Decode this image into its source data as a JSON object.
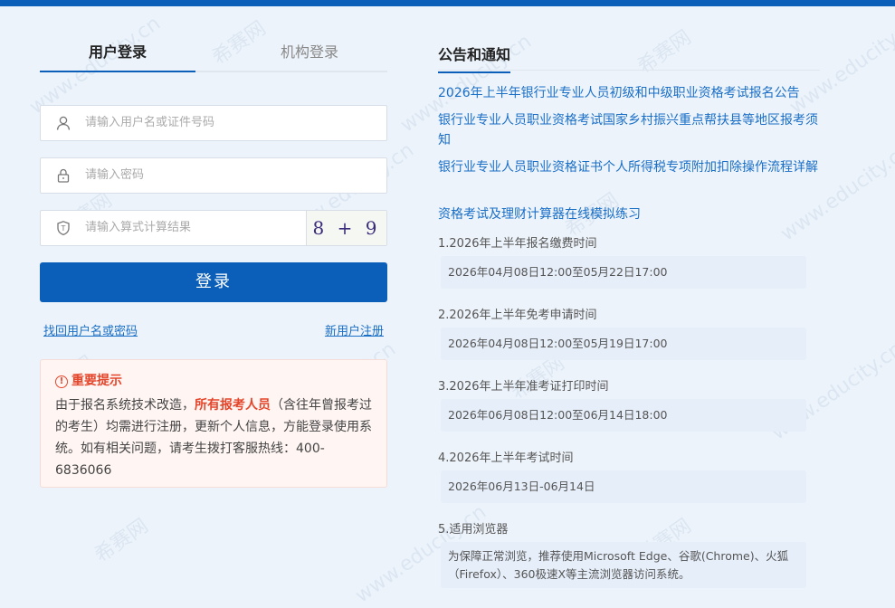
{
  "tabs": {
    "user_login": "用户登录",
    "org_login": "机构登录"
  },
  "form": {
    "username_placeholder": "请输入用户名或证件号码",
    "password_placeholder": "请输入密码",
    "captcha_placeholder": "请输入算式计算结果",
    "captcha_text": "8 + 9 =",
    "login_label": "登录",
    "forgot_label": "找回用户名或密码",
    "register_label": "新用户注册"
  },
  "notice": {
    "title": "重要提示",
    "body_before": "由于报名系统技术改造，",
    "body_highlight": "所有报考人员",
    "body_after": "（含往年曾报考过的考生）均需进行注册，更新个人信息，方能登录使用系统。如有相关问题，请考生拨打客服热线：400-6836066"
  },
  "announcements": {
    "title": "公告和通知",
    "items": [
      "2026年上半年银行业专业人员初级和中级职业资格考试报名公告",
      "银行业专业人员职业资格考试国家乡村振兴重点帮扶县等地区报考须知",
      "银行业专业人员职业资格证书个人所得税专项附加扣除操作流程详解",
      "资格考试及理财计算器在线模拟练习"
    ]
  },
  "schedule": [
    {
      "title": "1.2026年上半年报名缴费时间",
      "value": "2026年04月08日12:00至05月22日17:00"
    },
    {
      "title": "2.2026年上半年免考申请时间",
      "value": "2026年04月08日12:00至05月19日17:00"
    },
    {
      "title": "3.2026年上半年准考证打印时间",
      "value": "2026年06月08日12:00至06月14日18:00"
    },
    {
      "title": "4.2026年上半年考试时间",
      "value": "2026年06月13日-06月14日"
    },
    {
      "title": "5.适用浏览器",
      "value": "为保障正常浏览，推荐使用Microsoft Edge、谷歌(Chrome)、火狐（Firefox）、360极速X等主流浏览器访问系统。"
    }
  ],
  "watermark": {
    "text": "www.educity.cn",
    "brand": "希赛网"
  },
  "colors": {
    "primary": "#0b5fb8",
    "link": "#1a6fc7",
    "warning": "#e4462b"
  }
}
